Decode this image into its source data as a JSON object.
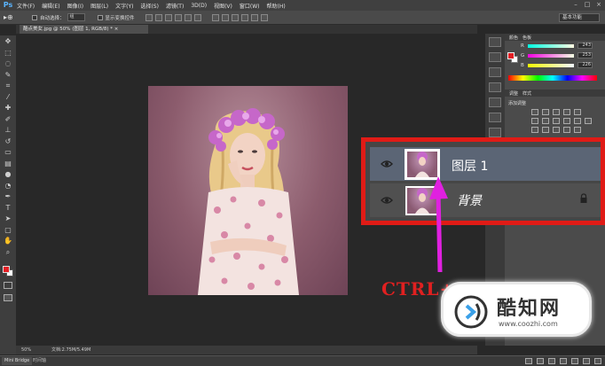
{
  "menubar": {
    "app_logo": "Ps",
    "items": [
      "文件(F)",
      "编辑(E)",
      "图像(I)",
      "图层(L)",
      "文字(Y)",
      "选择(S)",
      "滤镜(T)",
      "3D(D)",
      "视图(V)",
      "窗口(W)",
      "帮助(H)"
    ],
    "window_buttons": [
      "–",
      "□",
      "×"
    ]
  },
  "optbar": {
    "auto_select_label": "自动选择：",
    "auto_select_value": "组",
    "show_transform_label": "显示变换控件",
    "workspace": "基本功能"
  },
  "document": {
    "tab_title": "酷点美女.jpg @ 50% (图层 1, RGB/8) * ×"
  },
  "color_panel": {
    "tabs": [
      "颜色",
      "色板"
    ],
    "channels": [
      {
        "label": "R",
        "value": "243"
      },
      {
        "label": "G",
        "value": "253"
      },
      {
        "label": "B",
        "value": "226"
      }
    ]
  },
  "adjust_panel": {
    "tabs": [
      "调整",
      "样式"
    ],
    "title": "添加调整"
  },
  "statusbar": {
    "zoom": "50%",
    "doc_info": "文档:2.75M/5.49M"
  },
  "bottom_tabs": {
    "mini_bridge": "Mini Bridge",
    "timeline": "时间轴"
  },
  "layers": {
    "rows": [
      {
        "name": "图层 1",
        "selected": true
      },
      {
        "name": "背景",
        "locked": true
      }
    ]
  },
  "annotation": {
    "shortcut_text": "CTRL+J",
    "highlight_color": "#e01b16",
    "arrow_color": "#e020e0"
  },
  "watermark": {
    "brand": "酷知网",
    "url": "www.coozhi.com"
  }
}
